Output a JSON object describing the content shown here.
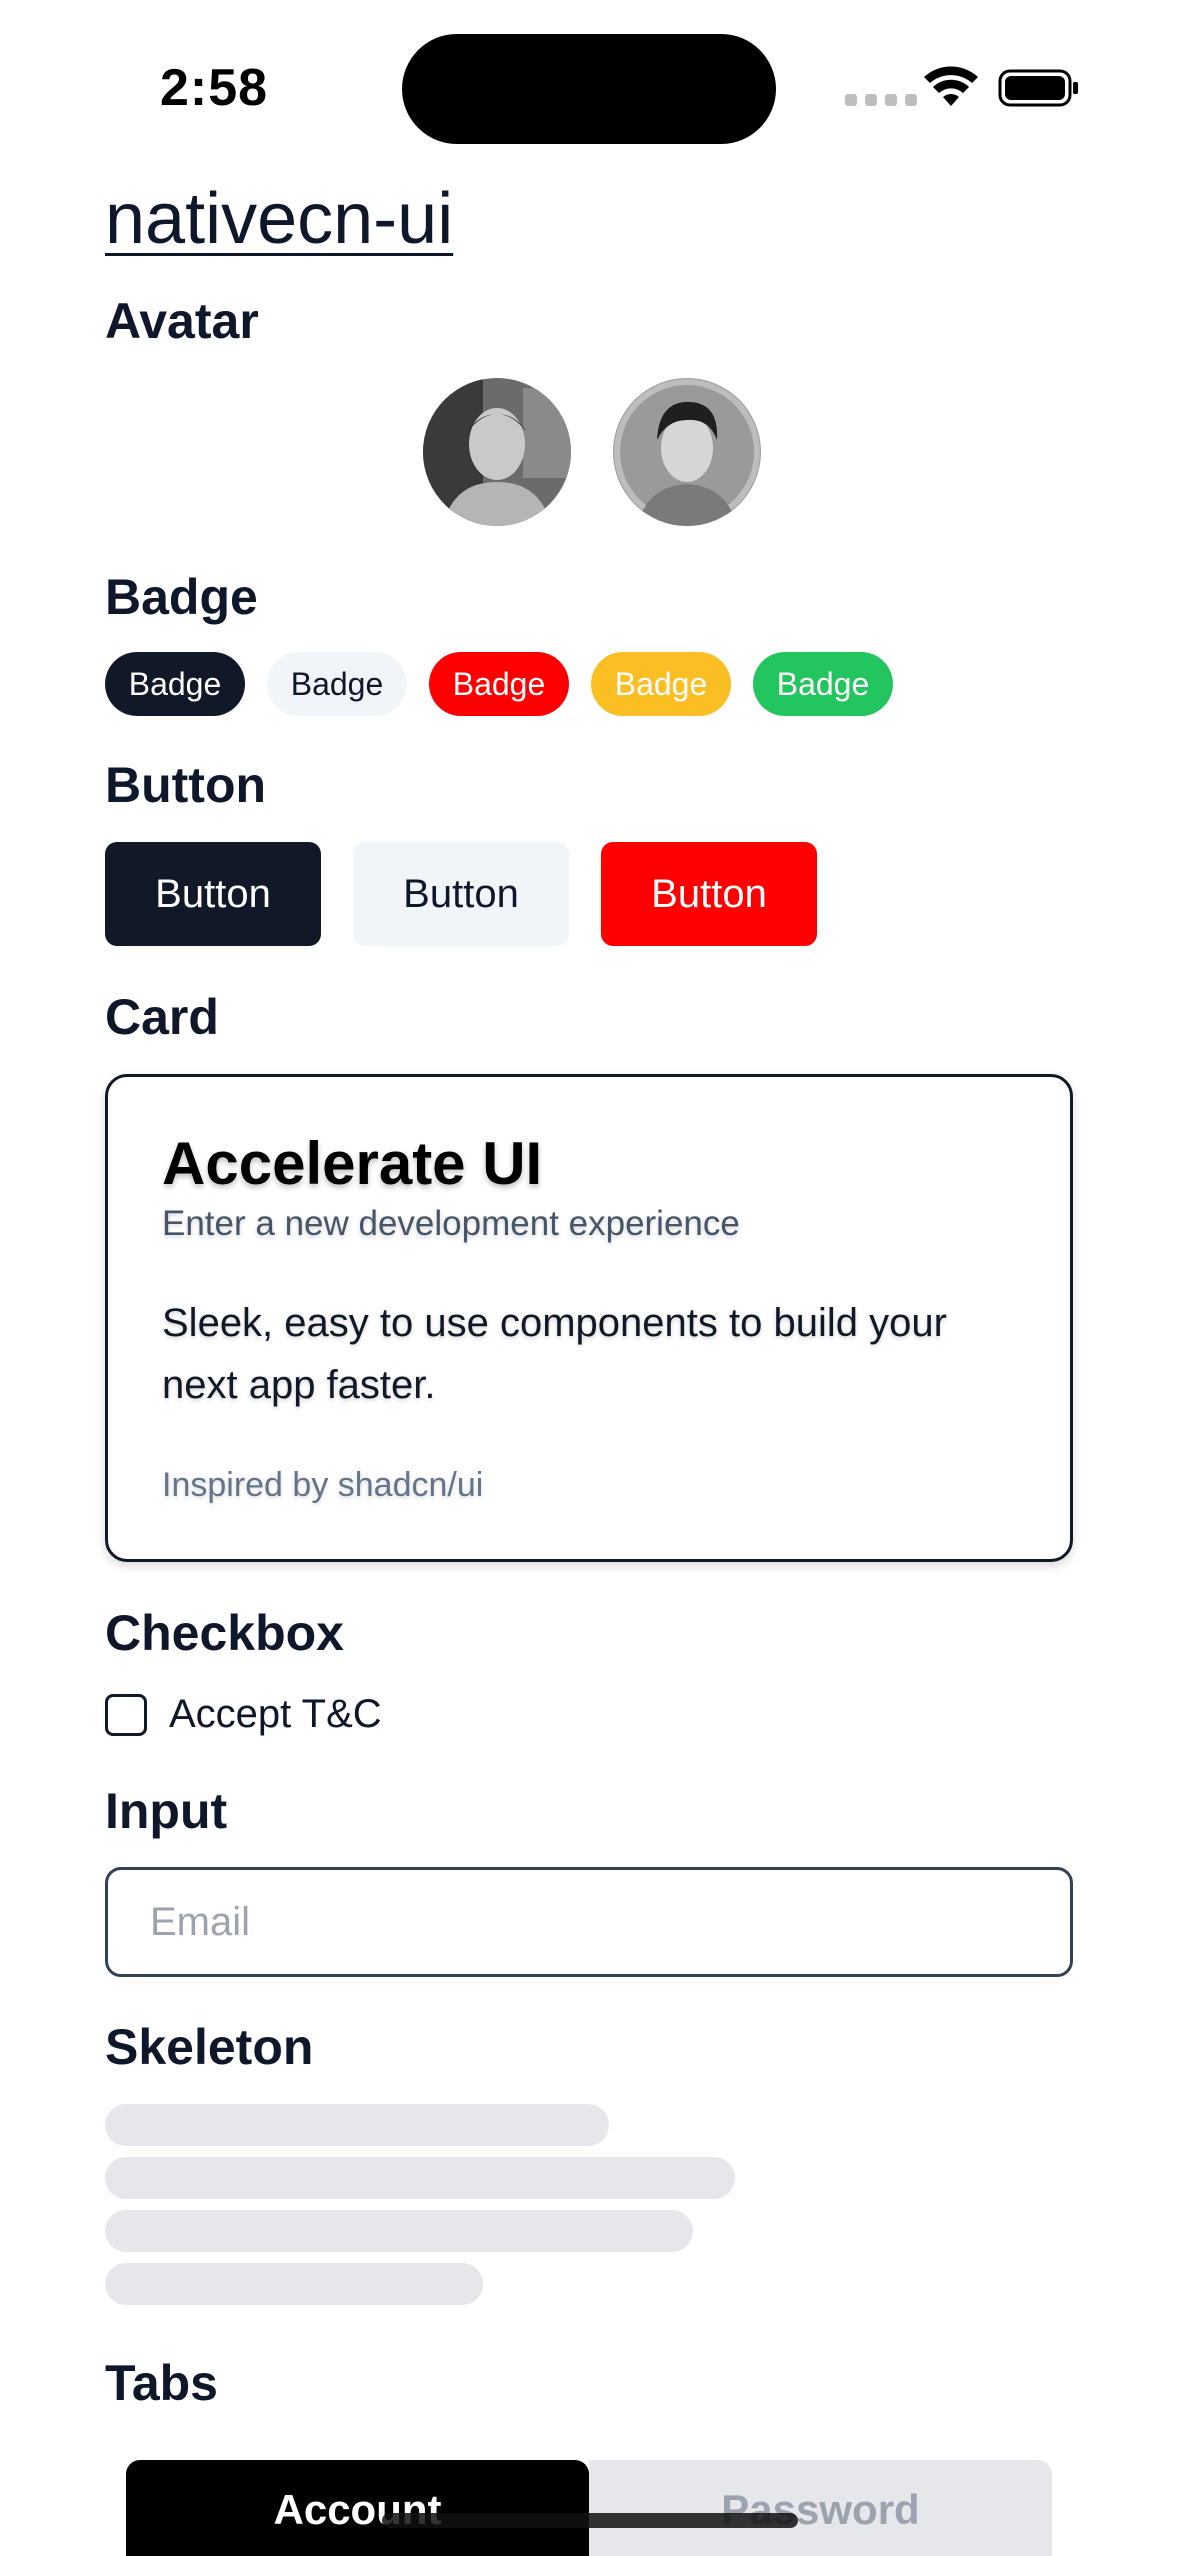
{
  "status_bar": {
    "time": "2:58"
  },
  "app": {
    "title": "nativecn-ui"
  },
  "sections": {
    "avatar": "Avatar",
    "badge": "Badge",
    "button": "Button",
    "card": "Card",
    "checkbox": "Checkbox",
    "input": "Input",
    "skeleton": "Skeleton",
    "tabs": "Tabs"
  },
  "badges": [
    {
      "label": "Badge",
      "variant": "default",
      "bg": "#111827",
      "fg": "#ffffff"
    },
    {
      "label": "Badge",
      "variant": "secondary",
      "bg": "#f1f5f9",
      "fg": "#0f172a"
    },
    {
      "label": "Badge",
      "variant": "destructive",
      "bg": "#ff0000",
      "fg": "#ffffff"
    },
    {
      "label": "Badge",
      "variant": "warning",
      "bg": "#fbbf24",
      "fg": "#ffffff"
    },
    {
      "label": "Badge",
      "variant": "success",
      "bg": "#22c55e",
      "fg": "#ffffff"
    }
  ],
  "buttons": [
    {
      "label": "Button",
      "variant": "default",
      "bg": "#111827",
      "fg": "#ffffff"
    },
    {
      "label": "Button",
      "variant": "secondary",
      "bg": "#f1f5f9",
      "fg": "#0f172a"
    },
    {
      "label": "Button",
      "variant": "destructive",
      "bg": "#ff0000",
      "fg": "#ffffff"
    }
  ],
  "card": {
    "title": "Accelerate UI",
    "description": "Enter a new development experience",
    "body": "Sleek, easy to use components to build your next app faster.",
    "footer": "Inspired by shadcn/ui"
  },
  "checkbox": {
    "label": "Accept T&C",
    "checked": false
  },
  "input": {
    "value": "",
    "placeholder": "Email"
  },
  "tabs": [
    {
      "label": "Account",
      "active": true
    },
    {
      "label": "Password",
      "active": false
    }
  ],
  "colors": {
    "primary": "#111827",
    "secondary": "#f1f5f9",
    "destructive": "#ff0000",
    "skeleton": "#e5e7eb"
  }
}
